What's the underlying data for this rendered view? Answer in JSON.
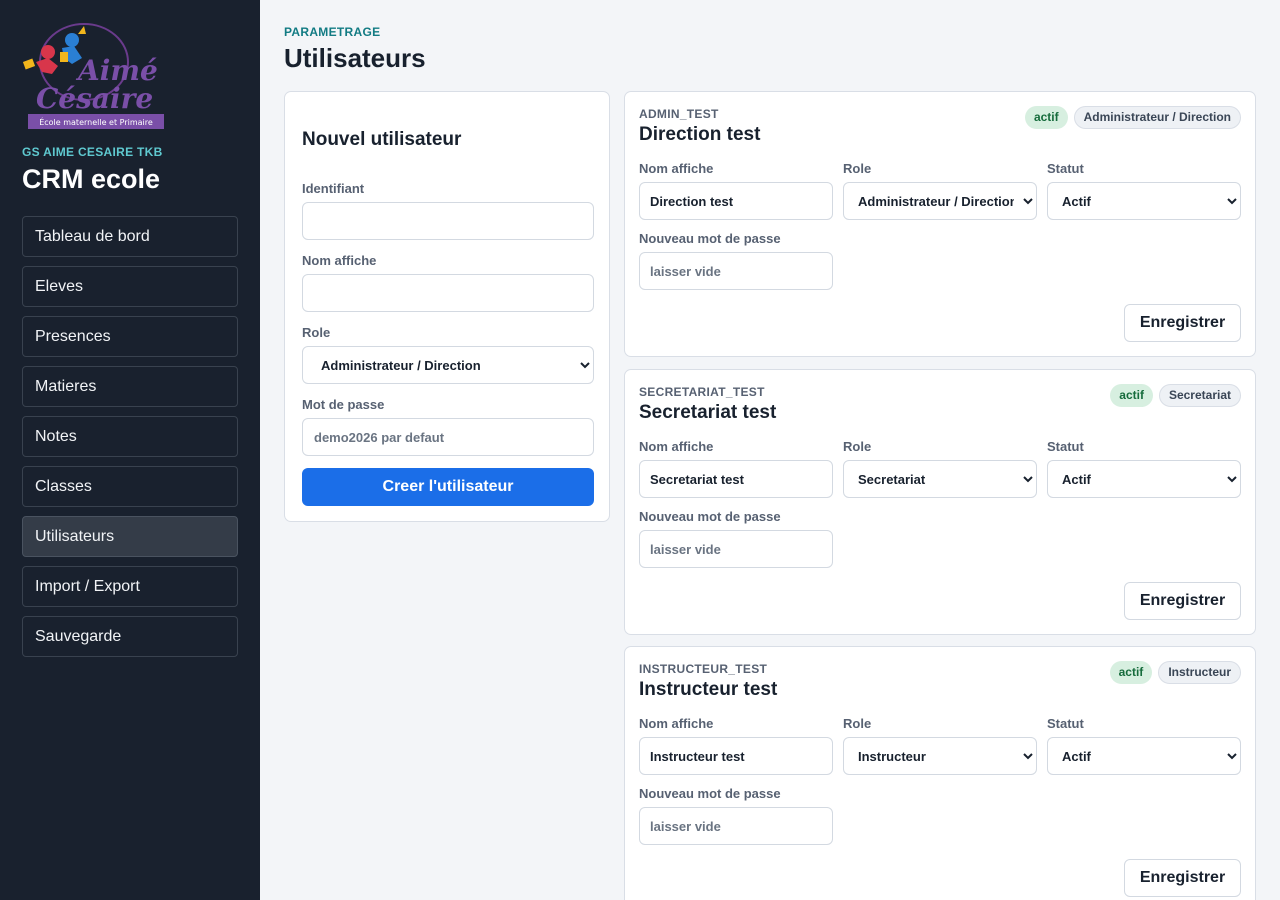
{
  "sidebar": {
    "logo": {
      "line1": "Aimé",
      "line2": "Césaire",
      "tagline": "École maternelle et Primaire"
    },
    "school_code": "GS AIME CESAIRE TKB",
    "app_name": "CRM ecole",
    "items": [
      {
        "label": "Tableau de bord"
      },
      {
        "label": "Eleves"
      },
      {
        "label": "Presences"
      },
      {
        "label": "Matieres"
      },
      {
        "label": "Notes"
      },
      {
        "label": "Classes"
      },
      {
        "label": "Utilisateurs",
        "active": true
      },
      {
        "label": "Import / Export"
      },
      {
        "label": "Sauvegarde"
      }
    ]
  },
  "header": {
    "eyebrow": "PARAMETRAGE",
    "title": "Utilisateurs"
  },
  "new_user": {
    "title": "Nouvel utilisateur",
    "identifiant_label": "Identifiant",
    "identifiant_value": "",
    "nom_label": "Nom affiche",
    "nom_value": "",
    "role_label": "Role",
    "role_value": "Administrateur / Direction",
    "password_label": "Mot de passe",
    "password_placeholder": "demo2026 par defaut",
    "submit_label": "Creer l'utilisateur"
  },
  "field_labels": {
    "nom": "Nom affiche",
    "role": "Role",
    "statut": "Statut",
    "password": "Nouveau mot de passe",
    "password_placeholder": "laisser vide",
    "save": "Enregistrer"
  },
  "users": [
    {
      "login": "ADMIN_TEST",
      "name": "Direction test",
      "status_badge": "actif",
      "role_badge": "Administrateur / Direction",
      "nom_value": "Direction test",
      "role_value": "Administrateur / Direction",
      "statut_value": "Actif"
    },
    {
      "login": "SECRETARIAT_TEST",
      "name": "Secretariat test",
      "status_badge": "actif",
      "role_badge": "Secretariat",
      "nom_value": "Secretariat test",
      "role_value": "Secretariat",
      "statut_value": "Actif"
    },
    {
      "login": "INSTRUCTEUR_TEST",
      "name": "Instructeur test",
      "status_badge": "actif",
      "role_badge": "Instructeur",
      "nom_value": "Instructeur test",
      "role_value": "Instructeur",
      "statut_value": "Actif"
    }
  ]
}
